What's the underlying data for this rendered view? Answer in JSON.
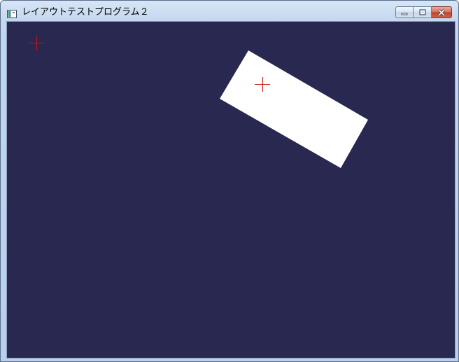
{
  "window": {
    "title": "レイアウトテストプログラム２",
    "icon": "application-icon"
  },
  "caption_buttons": [
    {
      "name": "minimize",
      "icon": "minimize-icon"
    },
    {
      "name": "maximize",
      "icon": "maximize-icon"
    },
    {
      "name": "close",
      "icon": "close-icon"
    }
  ],
  "canvas": {
    "background_color": "#292850",
    "shape_color": "#ffffff",
    "marker_color": "#cc1111",
    "shapes": [
      "rotated-rectangle"
    ],
    "markers": [
      "crosshair-origin",
      "crosshair-rect-anchor"
    ]
  }
}
